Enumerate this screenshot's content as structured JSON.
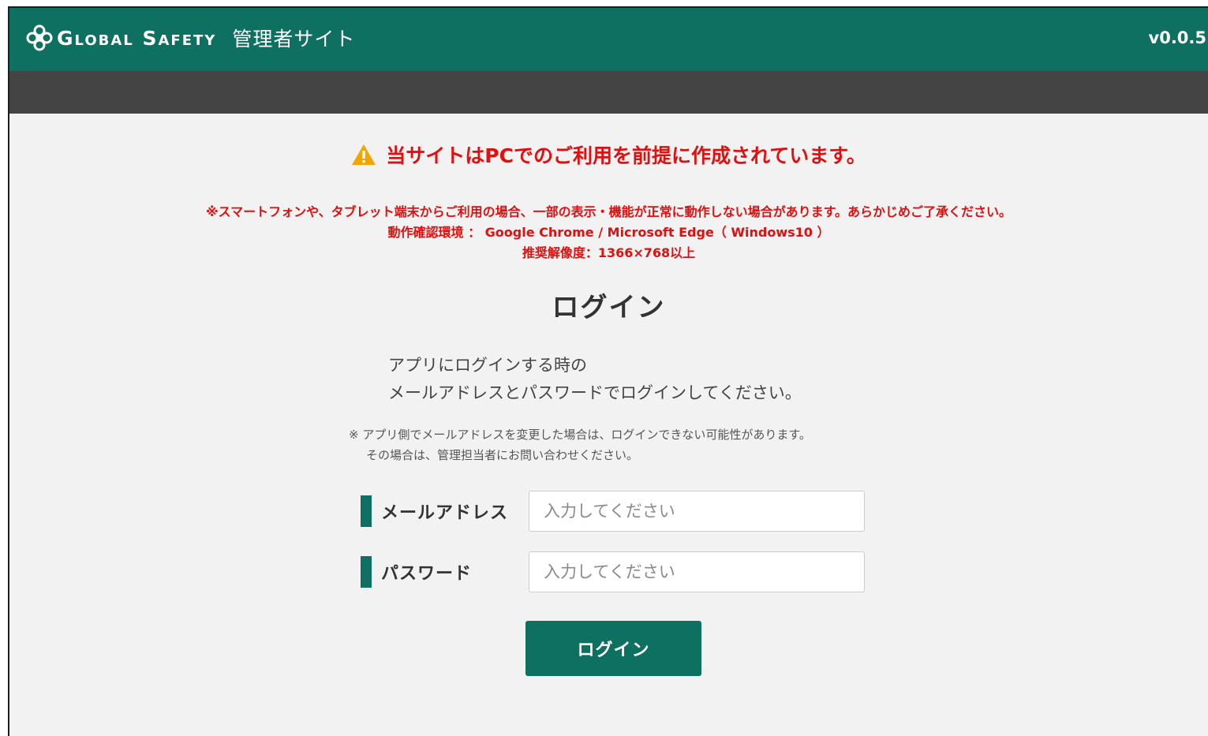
{
  "header": {
    "brand": "Global Safety",
    "site_name": "管理者サイト",
    "version": "v0.0.5",
    "logo_icon": "clover-logo-icon",
    "background_color": "#0e7060"
  },
  "subbar": {
    "color": "#444444"
  },
  "warning": {
    "icon": "warning-triangle-icon",
    "title": "当サイトはPCでのご利用を前提に作成されています。",
    "notes": [
      "※スマートフォンや、タブレット端末からご利用の場合、一部の表示・機能が正常に動作しない場合があります。あらかじめご了承ください。",
      "動作確認環境 ： Google Chrome / Microsoft Edge（ Windows10 ）",
      "推奨解像度：1366×768以上"
    ],
    "color": "#e01010"
  },
  "login": {
    "title": "ログイン",
    "instruction": [
      "アプリにログインする時の",
      "メールアドレスとパスワードでログインしてください。"
    ],
    "caution": [
      "※ アプリ側でメールアドレスを変更した場合は、ログインできない可能性があります。",
      "その場合は、管理担当者にお問い合わせください。"
    ],
    "email": {
      "label": "メールアドレス",
      "placeholder": "入力してください",
      "value": ""
    },
    "password": {
      "label": "パスワード",
      "placeholder": "入力してください",
      "value": ""
    },
    "submit_label": "ログイン"
  }
}
